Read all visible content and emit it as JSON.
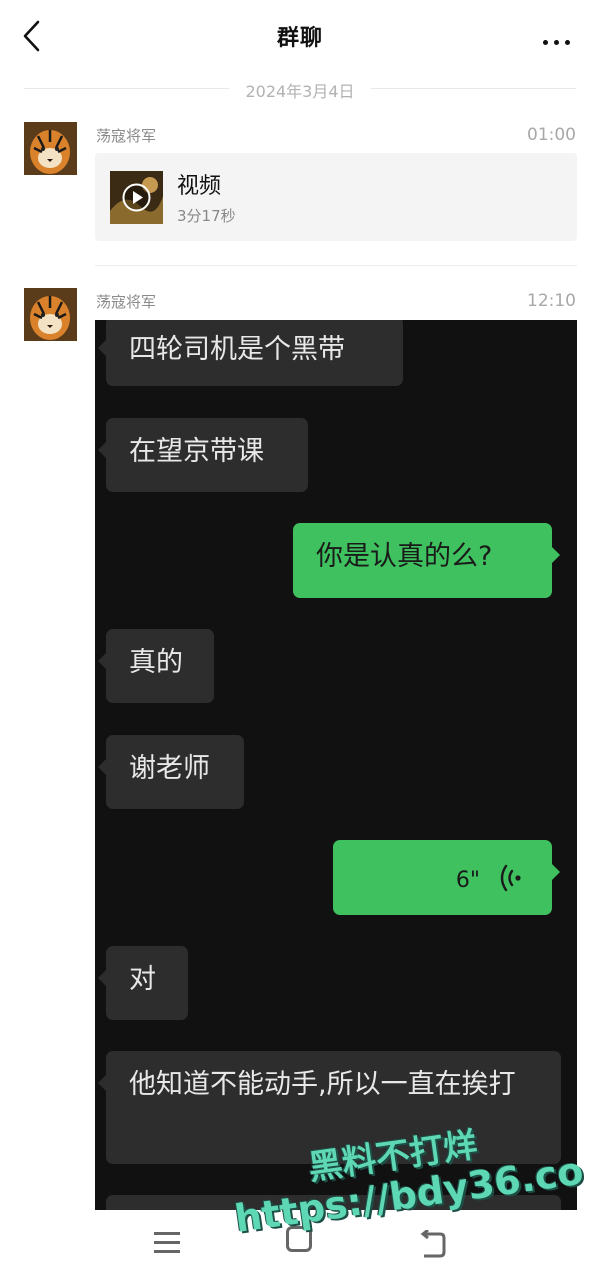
{
  "header": {
    "title": "群聊"
  },
  "date_separator": "2024年3月4日",
  "records": [
    {
      "sender": "荡寇将军",
      "time": "01:00",
      "video": {
        "title": "视频",
        "duration": "3分17秒"
      }
    },
    {
      "sender": "荡寇将军",
      "time": "12:10",
      "chat_screenshot": {
        "messages": [
          {
            "side": "in",
            "text": "四轮司机是个黑带"
          },
          {
            "side": "in",
            "text": "在望京带课"
          },
          {
            "side": "out",
            "text": "你是认真的么?"
          },
          {
            "side": "in",
            "text": "真的"
          },
          {
            "side": "in",
            "text": "谢老师"
          },
          {
            "side": "out",
            "type": "voice",
            "duration": "6\""
          },
          {
            "side": "in",
            "text": "对"
          },
          {
            "side": "in",
            "text": "他知道不能动手,所以一直在挨打"
          }
        ]
      }
    }
  ],
  "watermark": {
    "line1": "黑料不打烊",
    "line2": "https://bdy36.co"
  },
  "icons": {
    "back": "back-arrow-icon",
    "more": "more-dots-icon",
    "play": "play-icon",
    "voice": "voice-wave-icon",
    "nav": [
      "menu-icon",
      "home-icon",
      "return-icon"
    ]
  },
  "colors": {
    "outgoing_bubble": "#3ec15e",
    "incoming_bubble": "#2d2d2d",
    "screenshot_bg": "#111111"
  }
}
